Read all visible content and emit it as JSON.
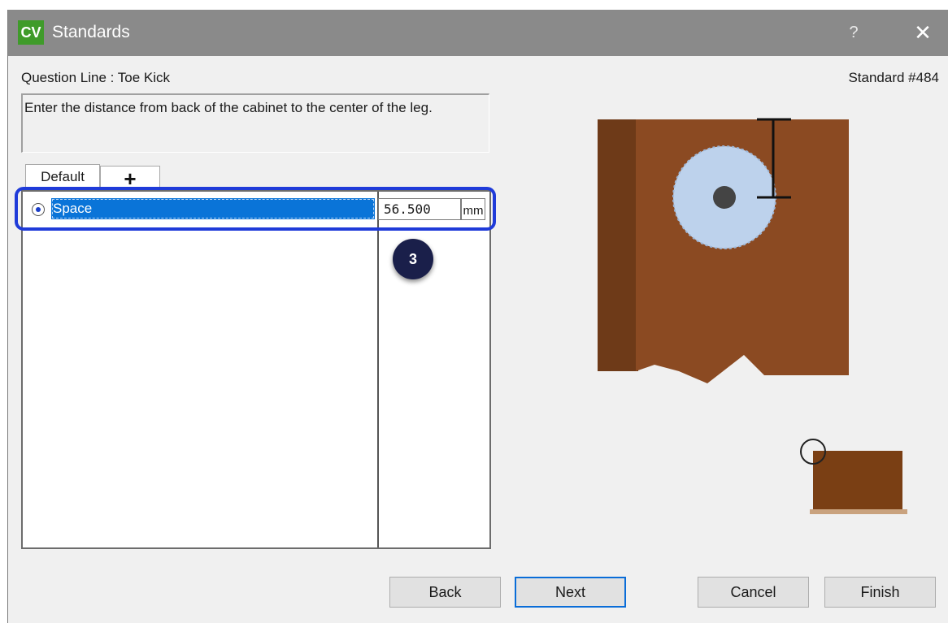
{
  "window": {
    "app_icon_text": "CV",
    "title": "Standards",
    "help_label": "?",
    "close_label": "✕"
  },
  "header": {
    "question_line": "Question Line : Toe Kick",
    "standard_number": "Standard #484"
  },
  "description": "Enter the distance  from back of the cabinet to the center of the leg.",
  "tabs": [
    {
      "label": "Default",
      "active": true
    },
    {
      "label": "+",
      "active": false
    }
  ],
  "rows": [
    {
      "label": "Space",
      "value": "56.500",
      "unit": "mm",
      "selected": true
    }
  ],
  "callout": {
    "step": "3"
  },
  "buttons": {
    "back": "Back",
    "next": "Next",
    "cancel": "Cancel",
    "finish": "Finish"
  },
  "colors": {
    "cabinet_brown": "#8b4a22",
    "leg_light_blue": "#bdd2ec",
    "selection_blue": "#0a74d8",
    "highlight_outline": "#1f3bd9",
    "title_bar": "#8a8a8a"
  },
  "icons": [
    "app-logo-icon",
    "help-icon",
    "close-icon",
    "radio-selected-icon",
    "add-tab-icon"
  ]
}
